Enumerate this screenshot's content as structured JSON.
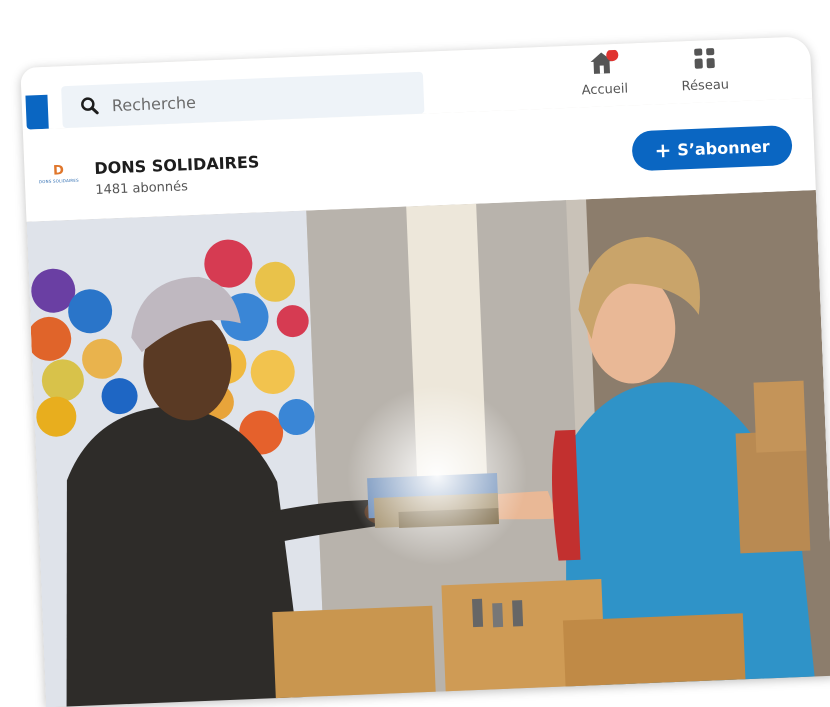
{
  "search": {
    "placeholder": "Recherche"
  },
  "nav": {
    "home_label": "Accueil",
    "network_label": "Réseau"
  },
  "company": {
    "name": "DONS SOLIDAIRES",
    "followers": "1481 abonnés",
    "logo_text": "DONS SOLIDAIRES"
  },
  "follow": {
    "label": "S’abonner"
  },
  "colors": {
    "brand": "#0a66c2",
    "notification": "#e0332f"
  },
  "icons": {
    "search": "search-icon",
    "home": "home-icon",
    "network": "network-icon",
    "follow": "plus-icon"
  }
}
